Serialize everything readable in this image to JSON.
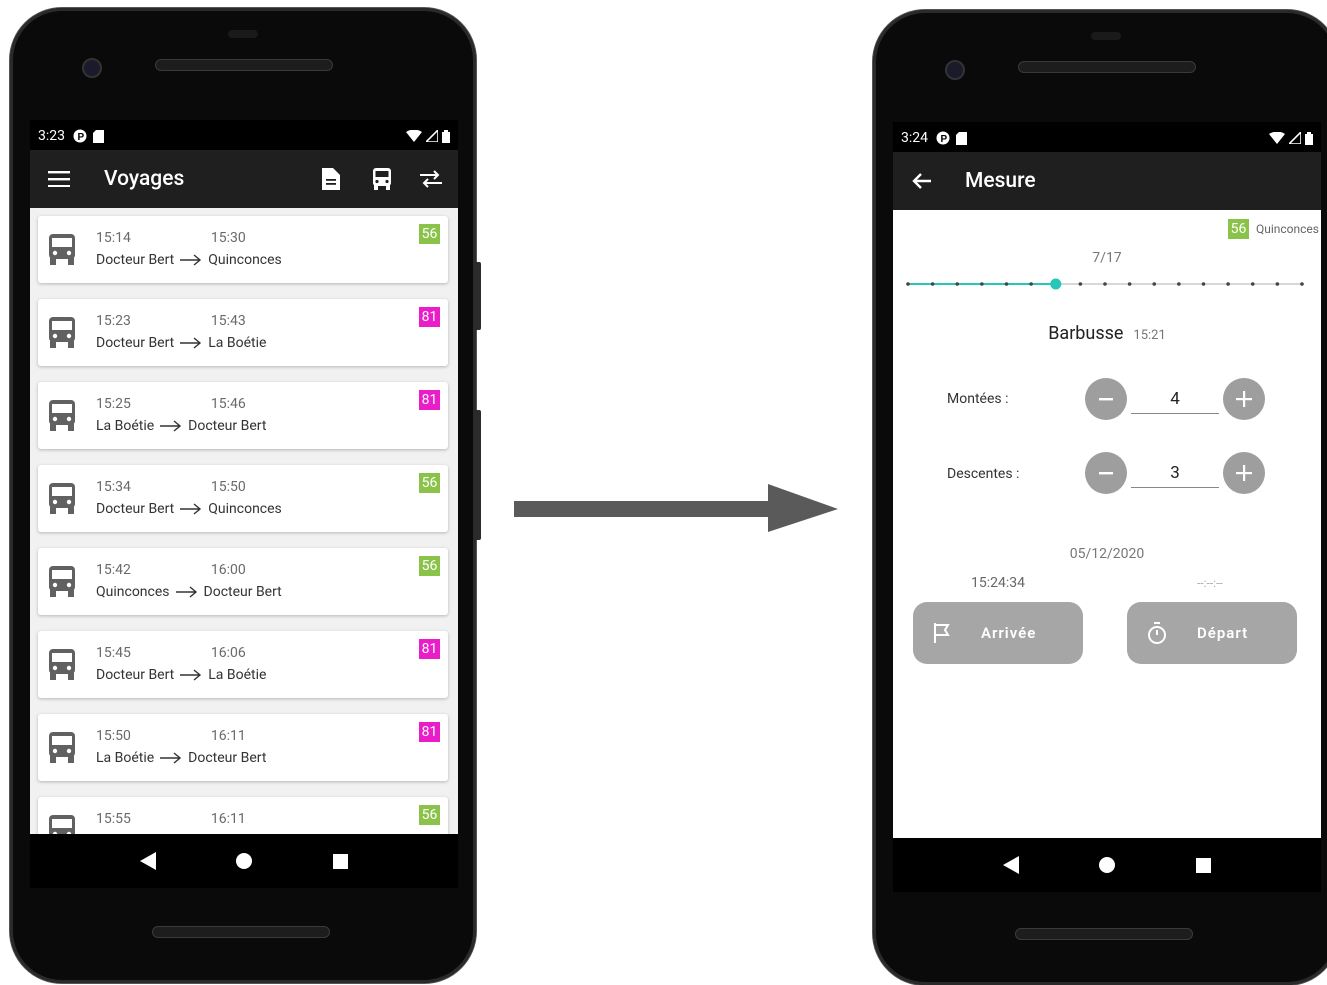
{
  "left_phone": {
    "status": {
      "time": "3:23"
    },
    "appbar": {
      "title": "Voyages"
    },
    "trips": [
      {
        "dep": "15:14",
        "arr": "15:30",
        "from": "Docteur Bert",
        "to": "Quinconces",
        "line": "56",
        "line_color": "#8bc34a"
      },
      {
        "dep": "15:23",
        "arr": "15:43",
        "from": "Docteur Bert",
        "to": "La Boétie",
        "line": "81",
        "line_color": "#e91ec8"
      },
      {
        "dep": "15:25",
        "arr": "15:46",
        "from": "La Boétie",
        "to": "Docteur Bert",
        "line": "81",
        "line_color": "#e91ec8"
      },
      {
        "dep": "15:34",
        "arr": "15:50",
        "from": "Docteur Bert",
        "to": "Quinconces",
        "line": "56",
        "line_color": "#8bc34a"
      },
      {
        "dep": "15:42",
        "arr": "16:00",
        "from": "Quinconces",
        "to": "Docteur Bert",
        "line": "56",
        "line_color": "#8bc34a"
      },
      {
        "dep": "15:45",
        "arr": "16:06",
        "from": "Docteur Bert",
        "to": "La Boétie",
        "line": "81",
        "line_color": "#e91ec8"
      },
      {
        "dep": "15:50",
        "arr": "16:11",
        "from": "La Boétie",
        "to": "Docteur Bert",
        "line": "81",
        "line_color": "#e91ec8"
      },
      {
        "dep": "15:55",
        "arr": "16:11",
        "from": "",
        "to": "",
        "line": "56",
        "line_color": "#8bc34a"
      }
    ]
  },
  "right_phone": {
    "status": {
      "time": "3:24"
    },
    "appbar": {
      "title": "Mesure"
    },
    "line_badge": "56",
    "line_color": "#8bc34a",
    "destination": "Quinconces",
    "progress": {
      "label": "7/17",
      "current": 7,
      "total": 17
    },
    "stop": {
      "name": "Barbusse",
      "time": "15:21"
    },
    "montees": {
      "label": "Montées :",
      "value": "4"
    },
    "descentes": {
      "label": "Descentes :",
      "value": "3"
    },
    "date": "05/12/2020",
    "arrival_time": "15:24:34",
    "departure_time": "--:--:--",
    "arrivee_label": "Arrivée",
    "depart_label": "Départ",
    "accent": "#26c6b8"
  }
}
